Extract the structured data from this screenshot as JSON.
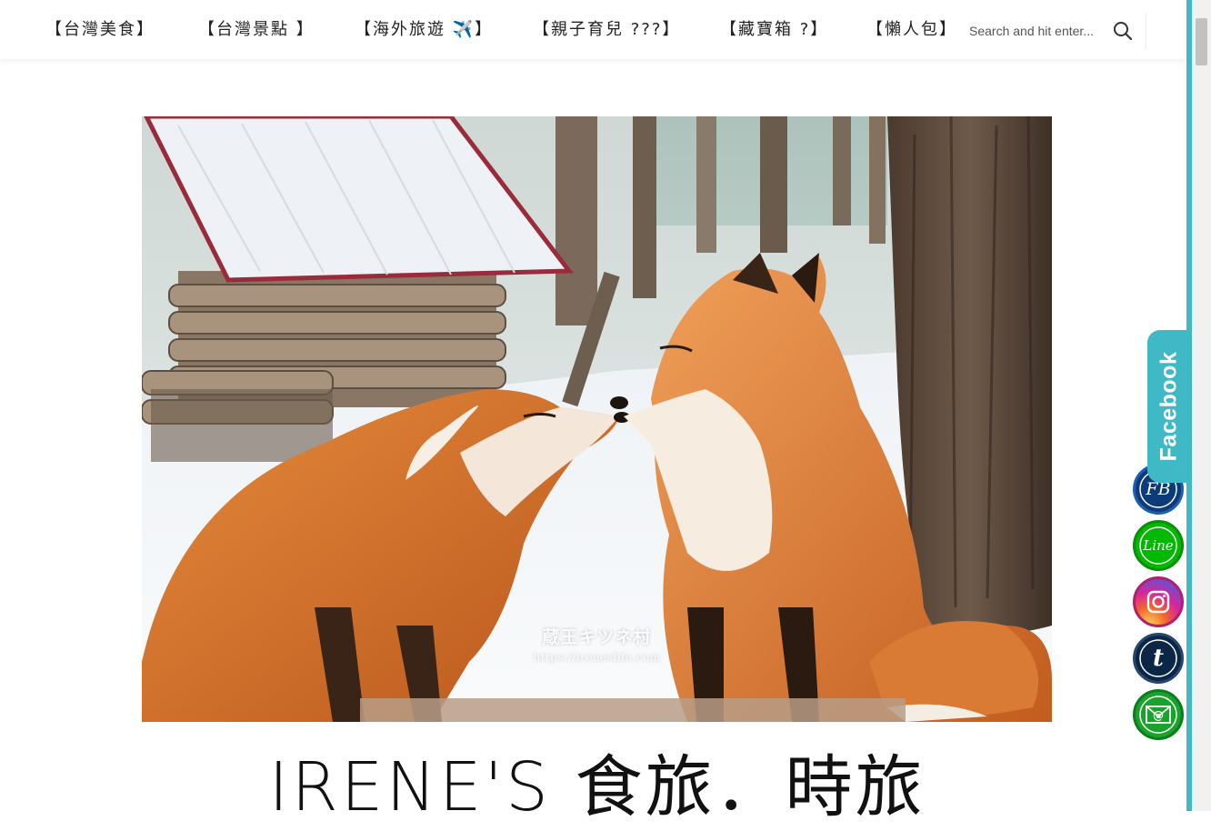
{
  "nav": {
    "items": [
      {
        "label": "【台灣美食】"
      },
      {
        "label": "【台灣景點 】"
      },
      {
        "label": "【海外旅遊 ✈️】"
      },
      {
        "label": "【親子育兒 ???】"
      },
      {
        "label": "【藏寶箱 ?】"
      },
      {
        "label": "【懶人包】"
      }
    ],
    "search": {
      "placeholder": "Search and hit enter..."
    }
  },
  "hero": {
    "watermark_title": "蔵王キツネ村",
    "watermark_url": "https://ireneslife.com"
  },
  "site": {
    "title": "IRENE'S 食旅．時旅"
  },
  "sidebar": {
    "facebook_tab": "Facebook",
    "social": [
      {
        "icon": "fb-icon",
        "label": "FB",
        "color": "#0d3b7a"
      },
      {
        "icon": "line-icon",
        "label": "Line",
        "color": "#00b900"
      },
      {
        "icon": "instagram-icon",
        "label": "",
        "color": "#d6249f"
      },
      {
        "icon": "tumblr-icon",
        "label": "t",
        "color": "#0b2646"
      },
      {
        "icon": "email-icon",
        "label": "@",
        "color": "#1aa32c"
      }
    ]
  },
  "colors": {
    "accent": "#3fb9c6",
    "fox_orange": "#d9702a",
    "snow": "#f4f6f8"
  }
}
